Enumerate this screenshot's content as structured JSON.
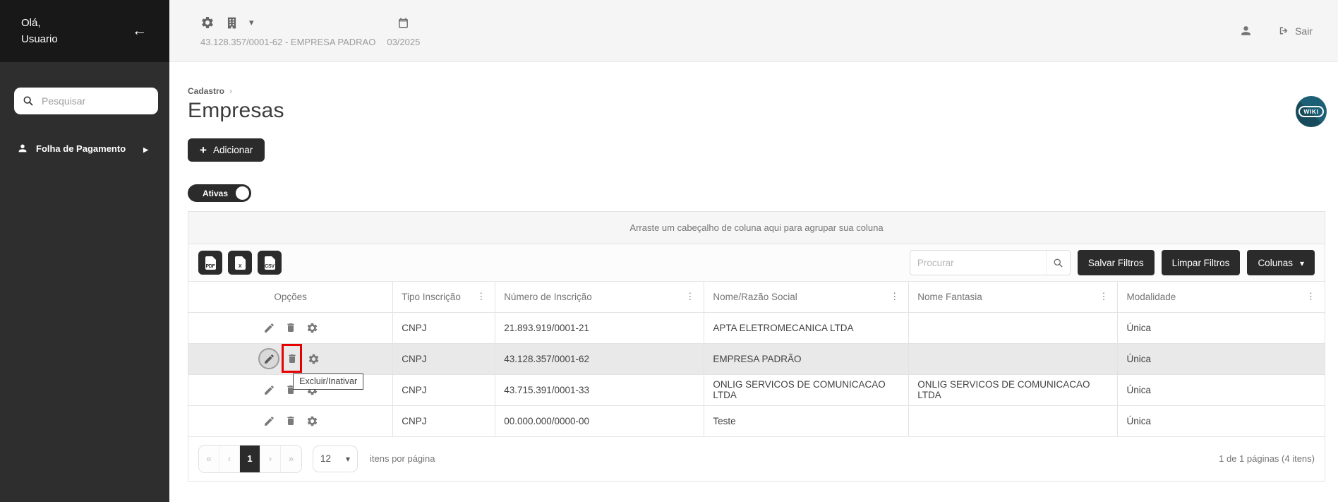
{
  "colors": {
    "accent": "#2b2b2b",
    "sidebar-top": "#181818",
    "sidebar-body": "#2e2e2e",
    "topbar-bg": "#f5f5f5",
    "highlight-red": "#e60000",
    "wiki-teal": "#1d6076",
    "selected-row": "#e9e9e9"
  },
  "sidebar": {
    "greeting": {
      "line1": "Olá,",
      "line2": "Usuario"
    },
    "search": {
      "placeholder": "Pesquisar"
    },
    "menu": [
      {
        "label": "Folha de Pagamento"
      }
    ]
  },
  "topbar": {
    "company_selector": {
      "value": "43.128.357/0001-62 - EMPRESA PADRAO"
    },
    "period": {
      "value": "03/2025"
    },
    "logout": {
      "label": "Sair"
    }
  },
  "page": {
    "breadcrumb": {
      "item": "Cadastro",
      "separator": "›"
    },
    "title": "Empresas",
    "buttons": {
      "add": "Adicionar"
    },
    "filter_toggle": {
      "label": "Ativas",
      "state": "on"
    },
    "wiki_badge": "WIKI"
  },
  "grid": {
    "group_hint": "Arraste um cabeçalho de coluna aqui para agrupar sua coluna",
    "toolbar": {
      "search_placeholder": "Procurar",
      "save_filters": "Salvar Filtros",
      "clear_filters": "Limpar Filtros",
      "columns_button": "Colunas",
      "export": [
        {
          "label": "PDF"
        },
        {
          "label": "X"
        },
        {
          "label": "CSV"
        }
      ]
    },
    "columns": [
      {
        "label": "Opções"
      },
      {
        "label": "Tipo Inscrição"
      },
      {
        "label": "Número de Inscrição"
      },
      {
        "label": "Nome/Razão Social"
      },
      {
        "label": "Nome Fantasia"
      },
      {
        "label": "Modalidade"
      }
    ],
    "rows": [
      {
        "tipo_inscricao": "CNPJ",
        "numero_inscricao": "21.893.919/0001-21",
        "razao_social": "APTA ELETROMECANICA LTDA",
        "nome_fantasia": "",
        "modalidade": "Única"
      },
      {
        "tipo_inscricao": "CNPJ",
        "numero_inscricao": "43.128.357/0001-62",
        "razao_social": "EMPRESA PADRÃO",
        "nome_fantasia": "",
        "modalidade": "Única"
      },
      {
        "tipo_inscricao": "CNPJ",
        "numero_inscricao": "43.715.391/0001-33",
        "razao_social": "ONLIG SERVICOS DE COMUNICACAO LTDA",
        "nome_fantasia": "ONLIG SERVICOS DE COMUNICACAO LTDA",
        "modalidade": "Única"
      },
      {
        "tipo_inscricao": "CNPJ",
        "numero_inscricao": "00.000.000/0000-00",
        "razao_social": "Teste",
        "nome_fantasia": "",
        "modalidade": "Única"
      }
    ],
    "tooltip": "Excluir/Inativar",
    "pagination": {
      "current_page": "1",
      "page_size": "12",
      "items_per_page_label": "itens por página",
      "summary": "1 de 1 páginas (4 itens)"
    }
  }
}
